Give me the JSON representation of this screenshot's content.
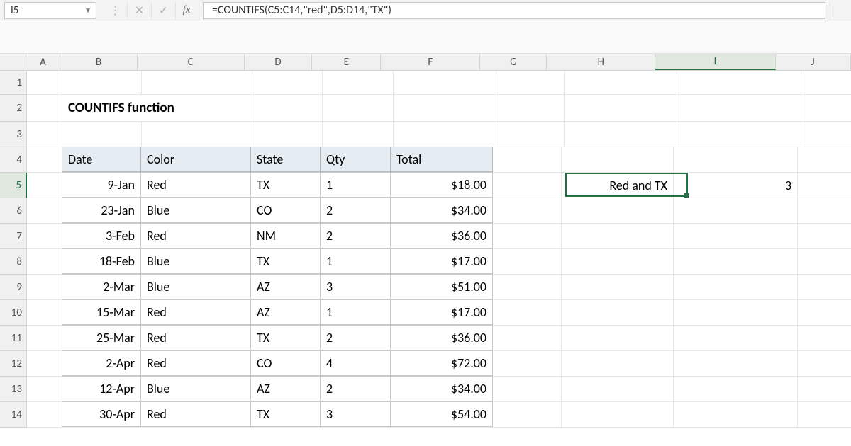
{
  "formula_bar": {
    "cell_ref": "I5",
    "fx_label": "fx",
    "formula": "=COUNTIFS(C5:C14,\"red\",D5:D14,\"TX\")"
  },
  "columns": [
    "A",
    "B",
    "C",
    "D",
    "E",
    "F",
    "G",
    "H",
    "I",
    "J"
  ],
  "rows": [
    "1",
    "2",
    "3",
    "4",
    "5",
    "6",
    "7",
    "8",
    "9",
    "10",
    "11",
    "12",
    "13",
    "14"
  ],
  "title": "COUNTIFS function",
  "table": {
    "headers": [
      "Date",
      "Color",
      "State",
      "Qty",
      "Total"
    ],
    "rows": [
      {
        "date": "9-Jan",
        "color": "Red",
        "state": "TX",
        "qty": "1",
        "total": "$18.00"
      },
      {
        "date": "23-Jan",
        "color": "Blue",
        "state": "CO",
        "qty": "2",
        "total": "$34.00"
      },
      {
        "date": "3-Feb",
        "color": "Red",
        "state": "NM",
        "qty": "2",
        "total": "$36.00"
      },
      {
        "date": "18-Feb",
        "color": "Blue",
        "state": "TX",
        "qty": "1",
        "total": "$17.00"
      },
      {
        "date": "2-Mar",
        "color": "Blue",
        "state": "AZ",
        "qty": "3",
        "total": "$51.00"
      },
      {
        "date": "15-Mar",
        "color": "Red",
        "state": "AZ",
        "qty": "1",
        "total": "$17.00"
      },
      {
        "date": "25-Mar",
        "color": "Red",
        "state": "TX",
        "qty": "2",
        "total": "$36.00"
      },
      {
        "date": "2-Apr",
        "color": "Red",
        "state": "CO",
        "qty": "4",
        "total": "$72.00"
      },
      {
        "date": "12-Apr",
        "color": "Blue",
        "state": "AZ",
        "qty": "2",
        "total": "$34.00"
      },
      {
        "date": "30-Apr",
        "color": "Red",
        "state": "TX",
        "qty": "3",
        "total": "$54.00"
      }
    ]
  },
  "result": {
    "label": "Red and TX",
    "value": "3"
  },
  "active_cell": "I5",
  "colors": {
    "excel_green": "#217346",
    "header_fill": "#e6edf2"
  }
}
